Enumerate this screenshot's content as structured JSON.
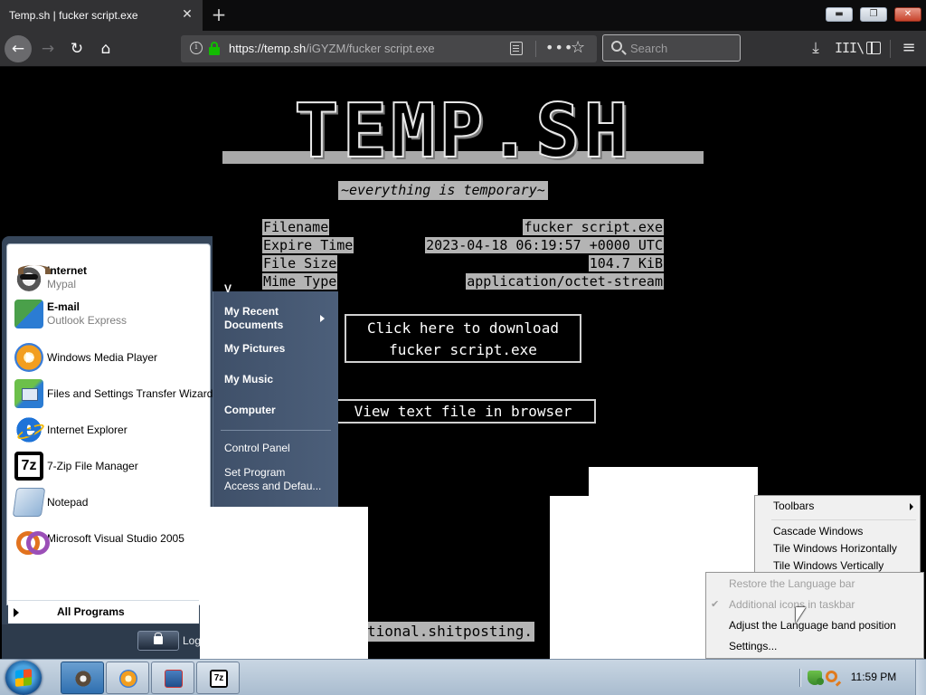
{
  "browser": {
    "tab_title": "Temp.sh | fucker script.exe",
    "tab_close": "✕",
    "new_tab": "+",
    "url_host": "https://temp.sh",
    "url_path": "/iGYZM/fucker script.exe",
    "search_placeholder": "Search",
    "window_controls": {
      "minimize": "▬",
      "maximize": "❐",
      "close": "✕"
    }
  },
  "icons": {
    "back": "←",
    "forward": "→",
    "reload": "↻",
    "home": "⌂",
    "more": "•••",
    "star": "☆",
    "download": "⤓",
    "library": "III\\",
    "menu": "≡"
  },
  "page": {
    "logo": "TEMP.SH",
    "tagline": "~everything is temporary~",
    "file_info": [
      {
        "key": "Filename",
        "value": "fucker script.exe"
      },
      {
        "key": "Expire Time",
        "value": "2023-04-18 06:19:57 +0000 UTC"
      },
      {
        "key": "File Size",
        "value": "104.7 KiB"
      },
      {
        "key": "Mime Type",
        "value": "application/octet-stream"
      }
    ],
    "download_line1": "Click here to download",
    "download_line2": "fucker script.exe",
    "view_text": "View text file in browser",
    "footer_partial": "tional.shitposting."
  },
  "start_menu": {
    "pinned": [
      {
        "main": "Internet",
        "sub": "Mypal",
        "icon": "mypal-icon"
      },
      {
        "main": "E-mail",
        "sub": "Outlook Express",
        "icon": "outlook-express-icon"
      }
    ],
    "recent": [
      {
        "label": "Windows Media Player",
        "icon": "windows-media-player-icon"
      },
      {
        "label": "Files and Settings Transfer Wizard",
        "icon": "transfer-wizard-icon"
      },
      {
        "label": "Internet Explorer",
        "icon": "internet-explorer-icon"
      },
      {
        "label": "7-Zip File Manager",
        "icon": "7zip-icon"
      },
      {
        "label": "Notepad",
        "icon": "notepad-icon"
      },
      {
        "label": "Microsoft Visual Studio 2005",
        "icon": "visual-studio-icon"
      }
    ],
    "all_programs": "All Programs",
    "log_text": "Log",
    "right_partial": "V",
    "right_items": {
      "recent_docs_1": "My Recent",
      "recent_docs_2": "Documents",
      "pictures": "My Pictures",
      "music": "My Music",
      "computer": "Computer",
      "control_panel": "Control Panel",
      "set_program_1": "Set Program",
      "set_program_2": "Access and Defau..."
    }
  },
  "taskbar_context_menu": {
    "toolbars": "Toolbars",
    "cascade": "Cascade Windows",
    "tile_h": "Tile Windows Horizontally",
    "tile_v": "Tile Windows Vertically"
  },
  "language_context_menu": {
    "restore": "Restore the Language bar",
    "additional": "Additional icons in taskbar",
    "adjust": "Adjust the Language band position",
    "settings": "Settings...",
    "check": "✔"
  },
  "taskbar": {
    "clock": "11:59 PM"
  }
}
